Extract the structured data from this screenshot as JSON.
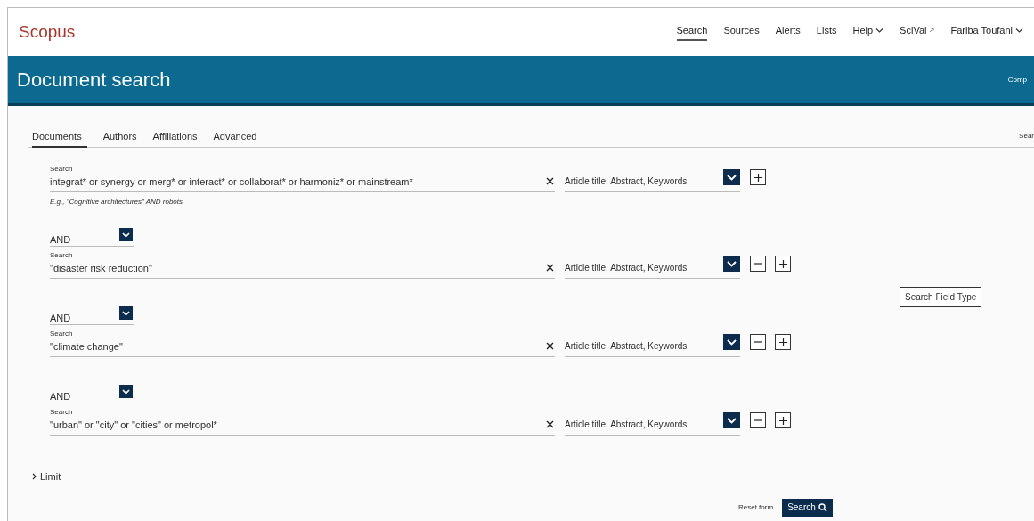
{
  "brand": "Scopus",
  "nav": [
    {
      "label": "Search",
      "selected": true,
      "menu": false,
      "external": false
    },
    {
      "label": "Sources",
      "selected": false,
      "menu": false,
      "external": false
    },
    {
      "label": "Alerts",
      "selected": false,
      "menu": false,
      "external": false
    },
    {
      "label": "Lists",
      "selected": false,
      "menu": false,
      "external": false
    },
    {
      "label": "Help",
      "selected": false,
      "menu": true,
      "external": false
    },
    {
      "label": "SciVal",
      "selected": false,
      "menu": false,
      "external": true
    },
    {
      "label": "Fariba Toufani",
      "selected": false,
      "menu": true,
      "external": false
    }
  ],
  "header": {
    "title": "Document search",
    "link": "Comp"
  },
  "tabs": [
    {
      "label": "Documents",
      "selected": true
    },
    {
      "label": "Authors",
      "selected": false
    },
    {
      "label": "Affiliations",
      "selected": false
    },
    {
      "label": "Advanced",
      "selected": false
    }
  ],
  "tabs_link": "Sear",
  "search_rows": [
    {
      "label": "Search",
      "value": "integrat* or synergy or merg* or interact* or collaborat* or harmoniz* or mainstream*",
      "field": "Article title, Abstract, Keywords",
      "removable": false,
      "hint": "E.g., \"Cognitive architectures\" AND robots"
    },
    {
      "operator": "AND",
      "label": "Search",
      "value": "\"disaster risk reduction\"",
      "field": "Article title, Abstract, Keywords",
      "removable": true
    },
    {
      "operator": "AND",
      "label": "Search",
      "value": "\"climate change\"",
      "field": "Article title, Abstract, Keywords",
      "removable": true
    },
    {
      "operator": "AND",
      "label": "Search",
      "value": "\"urban\" or \"city\" or \"cities\" or metropol*",
      "field": "Article title, Abstract, Keywords",
      "removable": true
    }
  ],
  "tooltip": "Search Field Type",
  "limit": "Limit",
  "reset": "Reset form",
  "search_button": "Search"
}
